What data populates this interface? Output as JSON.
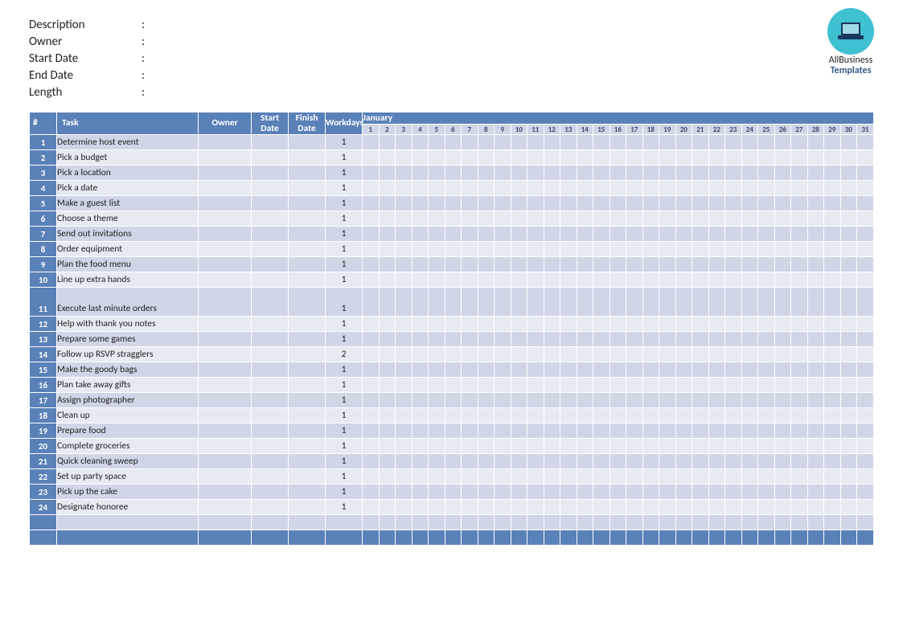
{
  "logo": {
    "line1": "AllBusiness",
    "line2": "Templates"
  },
  "meta": {
    "description_label": "Description",
    "owner_label": "Owner",
    "start_date_label": "Start Date",
    "end_date_label": "End Date",
    "length_label": "Length",
    "colon": ":"
  },
  "headers": {
    "num": "#",
    "task": "Task",
    "owner": "Owner",
    "start": "Start Date",
    "finish": "Finish Date",
    "workdays": "Workdays",
    "month": "January"
  },
  "days": [
    1,
    2,
    3,
    4,
    5,
    6,
    7,
    8,
    9,
    10,
    11,
    12,
    13,
    14,
    15,
    16,
    17,
    18,
    19,
    20,
    21,
    22,
    23,
    24,
    25,
    26,
    27,
    28,
    29,
    30,
    31
  ],
  "tasks": [
    {
      "n": 1,
      "name": "Determine host event",
      "owner": "",
      "start": "",
      "finish": "",
      "workdays": 1,
      "tall": false
    },
    {
      "n": 2,
      "name": "Pick a budget",
      "owner": "",
      "start": "",
      "finish": "",
      "workdays": 1,
      "tall": false
    },
    {
      "n": 3,
      "name": "Pick a location",
      "owner": "",
      "start": "",
      "finish": "",
      "workdays": 1,
      "tall": false
    },
    {
      "n": 4,
      "name": "Pick a date",
      "owner": "",
      "start": "",
      "finish": "",
      "workdays": 1,
      "tall": false
    },
    {
      "n": 5,
      "name": "Make a guest list",
      "owner": "",
      "start": "",
      "finish": "",
      "workdays": 1,
      "tall": false
    },
    {
      "n": 6,
      "name": "Choose a theme",
      "owner": "",
      "start": "",
      "finish": "",
      "workdays": 1,
      "tall": false
    },
    {
      "n": 7,
      "name": "Send out invitations",
      "owner": "",
      "start": "",
      "finish": "",
      "workdays": 1,
      "tall": false
    },
    {
      "n": 8,
      "name": "Order equipment",
      "owner": "",
      "start": "",
      "finish": "",
      "workdays": 1,
      "tall": false
    },
    {
      "n": 9,
      "name": "Plan the food menu",
      "owner": "",
      "start": "",
      "finish": "",
      "workdays": 1,
      "tall": false
    },
    {
      "n": 10,
      "name": "Line up extra hands",
      "owner": "",
      "start": "",
      "finish": "",
      "workdays": 1,
      "tall": false
    },
    {
      "n": 11,
      "name": "Execute last minute orders",
      "owner": "",
      "start": "",
      "finish": "",
      "workdays": 1,
      "tall": true
    },
    {
      "n": 12,
      "name": "Help with thank you notes",
      "owner": "",
      "start": "",
      "finish": "",
      "workdays": 1,
      "tall": false
    },
    {
      "n": 13,
      "name": "Prepare some games",
      "owner": "",
      "start": "",
      "finish": "",
      "workdays": 1,
      "tall": false
    },
    {
      "n": 14,
      "name": "Follow up RSVP stragglers",
      "owner": "",
      "start": "",
      "finish": "",
      "workdays": 2,
      "tall": false
    },
    {
      "n": 15,
      "name": "Make the goody bags",
      "owner": "",
      "start": "",
      "finish": "",
      "workdays": 1,
      "tall": false
    },
    {
      "n": 16,
      "name": "Plan take away gifts",
      "owner": "",
      "start": "",
      "finish": "",
      "workdays": 1,
      "tall": false
    },
    {
      "n": 17,
      "name": "Assign photographer",
      "owner": "",
      "start": "",
      "finish": "",
      "workdays": 1,
      "tall": false
    },
    {
      "n": 18,
      "name": "Clean up",
      "owner": "",
      "start": "",
      "finish": "",
      "workdays": 1,
      "tall": false
    },
    {
      "n": 19,
      "name": "Prepare food",
      "owner": "",
      "start": "",
      "finish": "",
      "workdays": 1,
      "tall": false
    },
    {
      "n": 20,
      "name": "Complete groceries",
      "owner": "",
      "start": "",
      "finish": "",
      "workdays": 1,
      "tall": false
    },
    {
      "n": 21,
      "name": "Quick cleaning sweep",
      "owner": "",
      "start": "",
      "finish": "",
      "workdays": 1,
      "tall": false
    },
    {
      "n": 22,
      "name": "Set up party space",
      "owner": "",
      "start": "",
      "finish": "",
      "workdays": 1,
      "tall": false
    },
    {
      "n": 23,
      "name": "Pick up the cake",
      "owner": "",
      "start": "",
      "finish": "",
      "workdays": 1,
      "tall": false
    },
    {
      "n": 24,
      "name": "Designate honoree",
      "owner": "",
      "start": "",
      "finish": "",
      "workdays": 1,
      "tall": false
    }
  ]
}
